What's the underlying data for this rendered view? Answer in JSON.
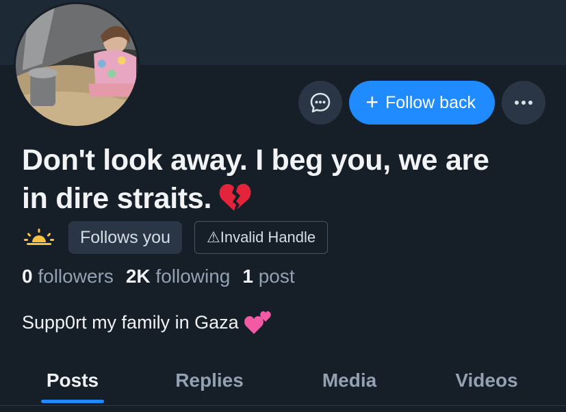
{
  "profile": {
    "display_name": "Don't look away. I beg you, we are in dire straits.",
    "bio": "Supp0rt my family in Gaza"
  },
  "actions": {
    "follow_back_label": "Follow back",
    "plus_glyph": "+"
  },
  "badges": {
    "follows_you": "Follows you",
    "invalid_handle": "⚠Invalid Handle"
  },
  "stats": {
    "followers_count": "0",
    "followers_label": "followers",
    "following_count": "2K",
    "following_label": "following",
    "posts_count": "1",
    "posts_label": "post"
  },
  "tabs": [
    {
      "label": "Posts",
      "active": true
    },
    {
      "label": "Replies",
      "active": false
    },
    {
      "label": "Media",
      "active": false
    },
    {
      "label": "Videos",
      "active": false
    }
  ],
  "icons": {
    "message": "message-icon",
    "more": "more-icon",
    "broken_heart": "broken-heart-emoji",
    "sunrise": "sunrise-icon",
    "two_hearts": "two-hearts-emoji"
  },
  "colors": {
    "background": "#161e27",
    "banner": "#1e2936",
    "accent": "#208bfe",
    "muted_text": "#93a2b3"
  }
}
